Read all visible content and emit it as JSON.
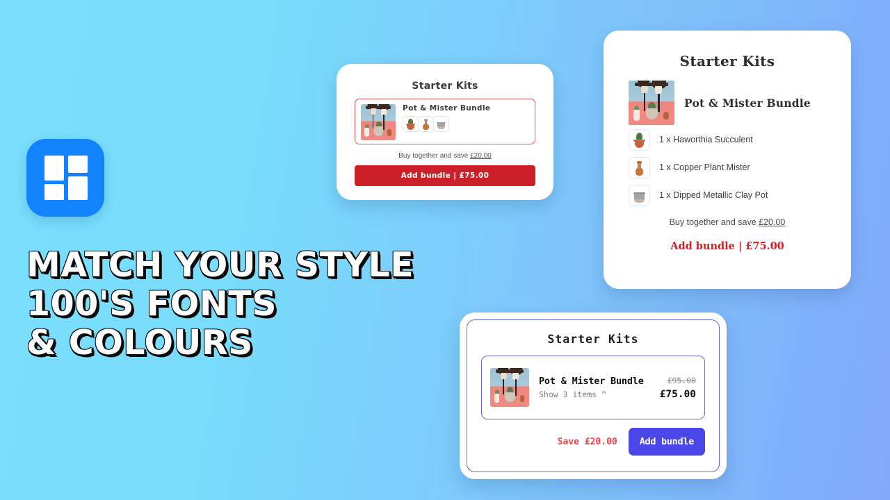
{
  "background": {
    "from": "#7adefc",
    "to": "#82aafb"
  },
  "promo": {
    "logo_icon": "grid-tiles-logo-icon",
    "headline": "Match Your Style\n100's Fonts\n& Colours"
  },
  "card_red": {
    "title": "Starter Kits",
    "product_name": "Pot & Mister Bundle",
    "product_image": "pot-and-mister-bundle-photo",
    "thumbnails": [
      "haworthia-succulent-thumb",
      "copper-plant-mister-thumb",
      "dipped-metallic-clay-pot-thumb"
    ],
    "save_prefix": "Buy together and save ",
    "save_amount": "£20.00",
    "cta_label": "Add bundle | £75.00",
    "accent": "#cc2028"
  },
  "card_serif": {
    "title": "Starter Kits",
    "product_name": "Pot & Mister Bundle",
    "product_image": "pot-and-mister-bundle-photo",
    "items": [
      {
        "label": "1 x Haworthia Succulent",
        "icon": "haworthia-succulent-thumb"
      },
      {
        "label": "1 x Copper Plant Mister",
        "icon": "copper-plant-mister-thumb"
      },
      {
        "label": "1 x Dipped Metallic Clay Pot",
        "icon": "dipped-metallic-clay-pot-thumb"
      }
    ],
    "save_prefix": "Buy together and save ",
    "save_amount": "£20.00",
    "cta_label": "Add bundle | £75.00",
    "accent": "#cc2028"
  },
  "card_mono": {
    "title": "Starter Kits",
    "product_name": "Pot & Mister Bundle",
    "product_image": "pot-and-mister-bundle-photo",
    "show_items_label": "Show 3 items  ^",
    "old_price": "£95.00",
    "new_price": "£75.00",
    "save_label": "Save £20.00",
    "cta_label": "Add bundle",
    "accent": "#4a46e8",
    "save_color": "#f4424b"
  }
}
